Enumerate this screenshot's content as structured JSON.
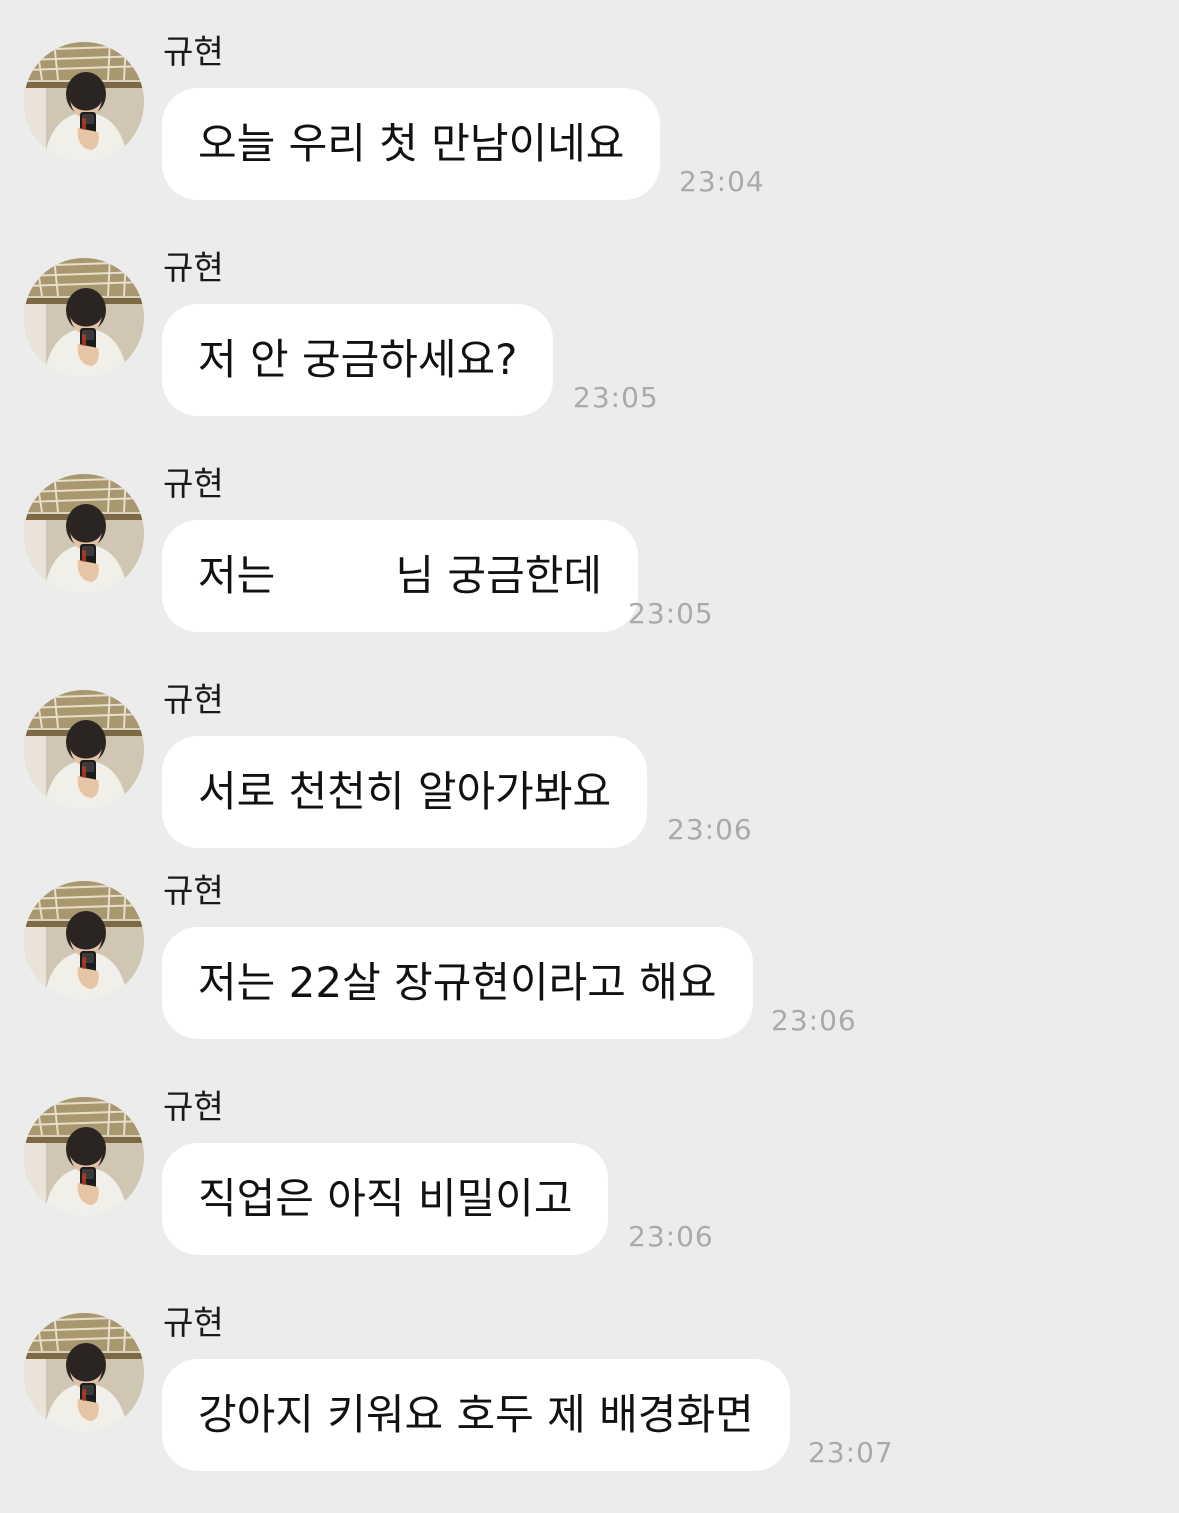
{
  "messages": [
    {
      "sender": "규현",
      "text": "오늘 우리 첫 만남이네요",
      "time": "23:04"
    },
    {
      "sender": "규현",
      "text": "저 안 궁금하세요?",
      "time": "23:05"
    },
    {
      "sender": "규현",
      "text": "저는         님 궁금한데",
      "time": "23:05"
    },
    {
      "sender": "규현",
      "text": "서로 천천히 알아가봐요",
      "time": "23:06"
    },
    {
      "sender": "규현",
      "text": "저는 22살 장규현이라고 해요",
      "time": "23:06"
    },
    {
      "sender": "규현",
      "text": "직업은 아직 비밀이고",
      "time": "23:06"
    },
    {
      "sender": "규현",
      "text": "강아지 키워요 호두 제 배경화면",
      "time": "23:07"
    }
  ],
  "colors": {
    "background": "#ececec",
    "bubble": "#ffffff",
    "timestamp": "#aaaaaa",
    "text": "#111111"
  },
  "icons": {
    "avatar": "profile-photo-avatar"
  }
}
